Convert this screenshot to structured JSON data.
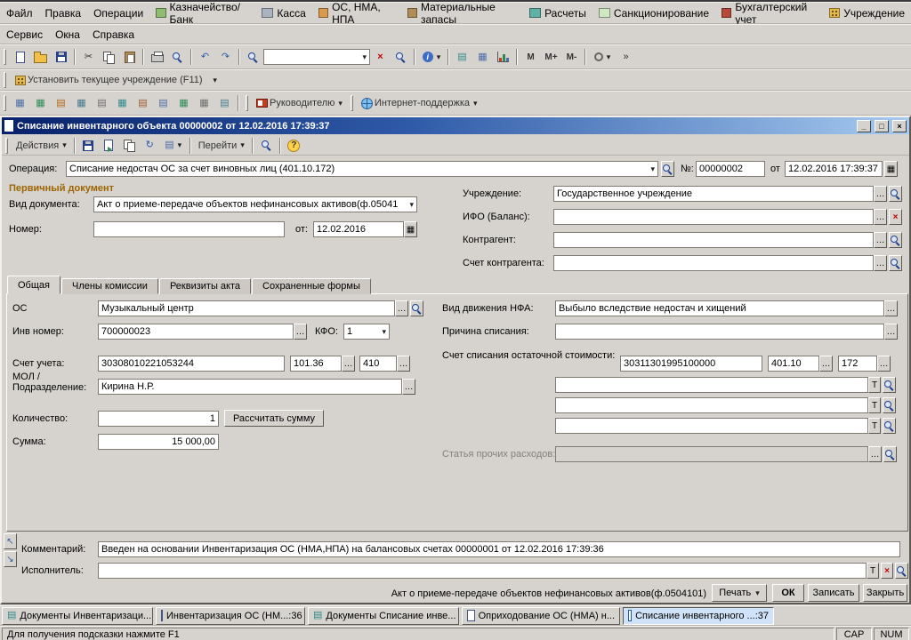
{
  "colors": {
    "window_bg": "#d6d3ce",
    "titlebar_start": "#08216b",
    "titlebar_end": "#a6caf0",
    "section_label": "#9c6500",
    "clear_button_red": "#c00000",
    "taskbar_active_bg": "#cfe2f7"
  },
  "icons": {
    "dropdown": "▾",
    "ellipsis": "…",
    "clear": "×",
    "calendar": "▦",
    "text_button": "Т",
    "help": "?",
    "info": "i",
    "cut": "✂",
    "undo": "↶",
    "redo": "↷",
    "refresh": "↻",
    "table": "▤",
    "grid": "▦",
    "minimize": "_",
    "restore": "□",
    "close": "×",
    "overflow": "»",
    "pin_nw": "↖",
    "pin_se": "↘"
  },
  "menus": {
    "main": [
      "Файл",
      "Правка",
      "Операции",
      "Казначейство/Банк",
      "Касса",
      "ОС, НМА, НПА",
      "Материальные запасы",
      "Расчеты",
      "Санкционирование",
      "Бухгалтерский учет",
      "Учреждение"
    ],
    "secondary": [
      "Сервис",
      "Окна",
      "Справка"
    ]
  },
  "toolbars": {
    "set_institution": "Установить текущее учреждение (F11)",
    "manager": "Руководителю",
    "support": "Интернет-поддержка",
    "memory": [
      "M",
      "M+",
      "M-"
    ]
  },
  "doc": {
    "title": "Списание инвентарного объекта 00000002 от 12.02.2016 17:39:37",
    "actions": "Действия",
    "goto": "Перейти",
    "operation_label": "Операция:",
    "operation": "Списание недостач ОС за счет виновных лиц (401.10.172)",
    "number_sign": "№:",
    "number": "00000002",
    "ot": "от",
    "datetime": "12.02.2016 17:39:37",
    "primary_section": "Первичный документ",
    "doc_type_label": "Вид документа:",
    "doc_type": "Акт о приеме-передаче объектов нефинансовых активов(ф.05041",
    "doc_number_label": "Номер:",
    "doc_number": "",
    "ot2": "от:",
    "doc_date": "12.02.2016",
    "institution_label": "Учреждение:",
    "institution": "Государственное учреждение",
    "ifo_label": "ИФО (Баланс):",
    "ifo": "",
    "counterparty_label": "Контрагент:",
    "counterparty": "",
    "cp_account_label": "Счет контрагента:",
    "cp_account": "",
    "tabs": [
      "Общая",
      "Члены комиссии",
      "Реквизиты акта",
      "Сохраненные формы"
    ],
    "general": {
      "os_label": "ОС",
      "os": "Музыкальный центр",
      "inv_label": "Инв номер:",
      "inv": "700000023",
      "kfo_label": "КФО:",
      "kfo": "1",
      "account_label": "Счет учета:",
      "account_code": "30308010221053244",
      "account": "101.36",
      "subaccount": "410",
      "mol_label": "МОЛ / Подразделение:",
      "mol": "Кирина Н.Р.",
      "qty_label": "Количество:",
      "qty": "1",
      "calc_sum": "Рассчитать сумму",
      "sum_label": "Сумма:",
      "sum": "15 000,00",
      "movement_label": "Вид движения НФА:",
      "movement": "Выбыло вследствие недостач и хищений",
      "reason_label": "Причина списания:",
      "reason": "",
      "writeoff_label": "Счет списания остаточной стоимости:",
      "writeoff_code": "30311301995100000",
      "writeoff_account": "401.10",
      "writeoff_sub": "172",
      "subconto1": "",
      "subconto2": "",
      "subconto3": "",
      "expense_label": "Статья прочих расходов:",
      "expense": ""
    },
    "comment_label": "Комментарий:",
    "comment": "Введен на основании Инвентаризация ОС (НМА,НПА) на балансовых счетах 00000001 от 12.02.2016 17:39:36",
    "executor_label": "Исполнитель:",
    "executor": "",
    "footer_form": "Акт о приеме-передаче объектов нефинансовых активов(ф.0504101)",
    "print": "Печать",
    "ok": "ОК",
    "save": "Записать",
    "close": "Закрыть"
  },
  "taskbar": {
    "items": [
      "Документы Инвентаризаци...",
      "Инвентаризация ОС (НМ...:36",
      "Документы Списание инве...",
      "Оприходование ОС (НМА) н...",
      "Списание инвентарного ...:37"
    ],
    "active_index": 4
  },
  "status": {
    "hint": "Для получения подсказки нажмите F1",
    "cap": "CAP",
    "num": "NUM"
  }
}
